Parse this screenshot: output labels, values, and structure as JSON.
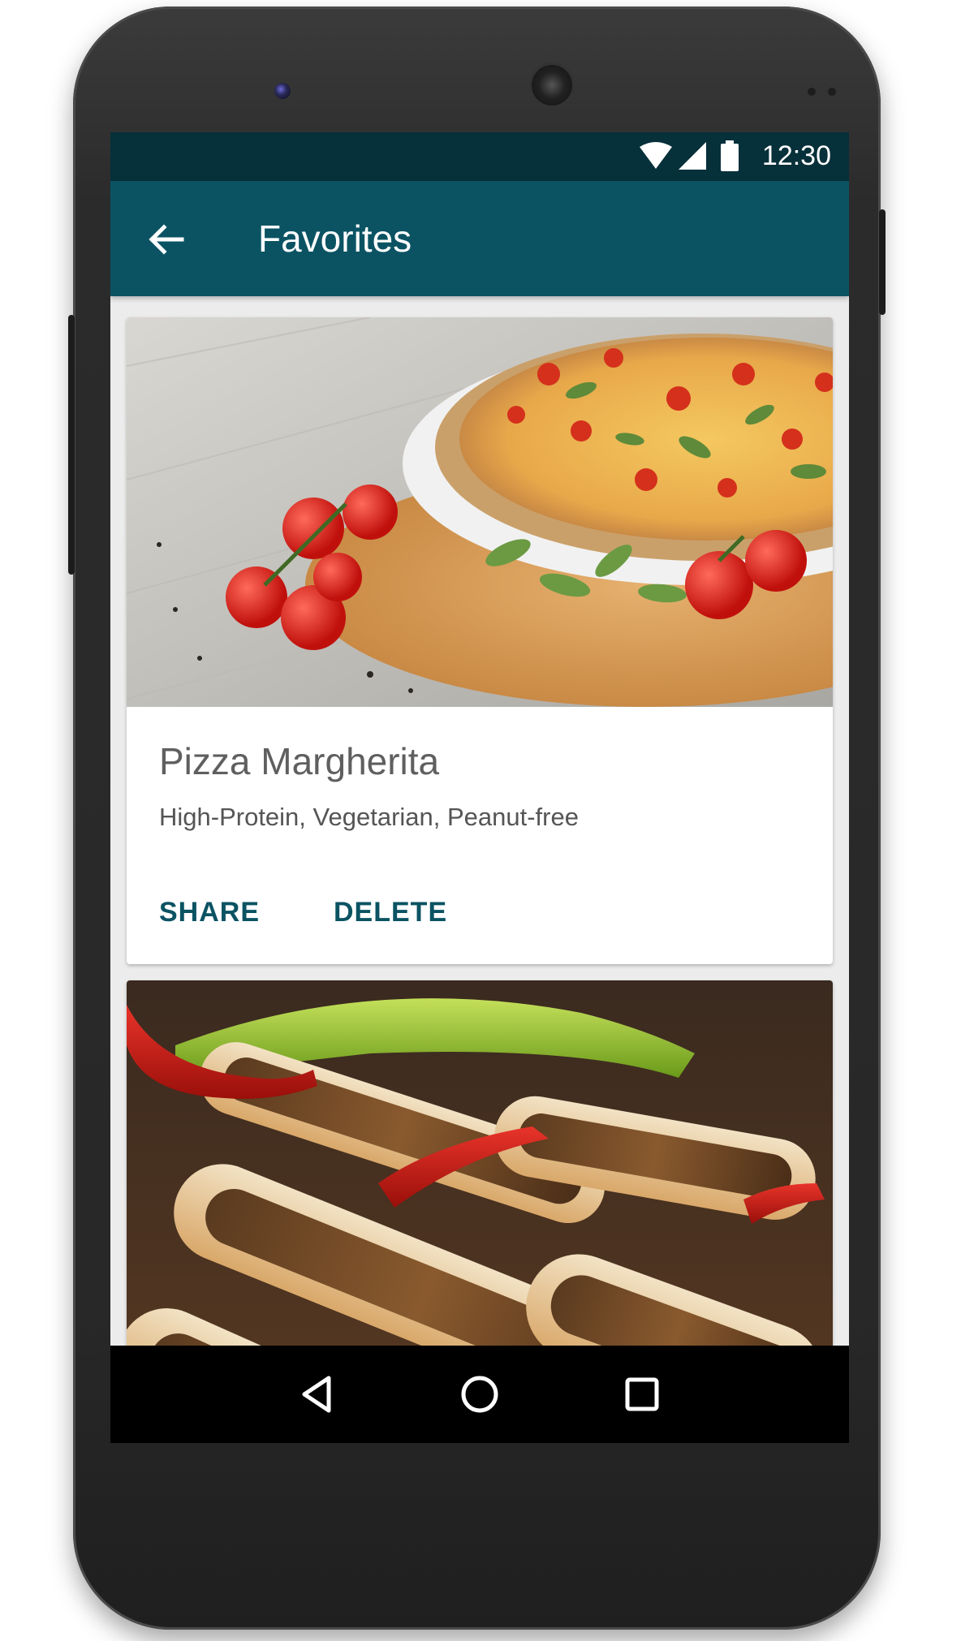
{
  "status_bar": {
    "time": "12:30",
    "icons": [
      "wifi-icon",
      "signal-icon",
      "battery-icon"
    ]
  },
  "app_bar": {
    "title": "Favorites",
    "nav_icon": "arrow-back-icon",
    "color": "#0b5363"
  },
  "cards": [
    {
      "title": "Pizza Margherita",
      "subtitle": "High-Protein, Vegetarian, Peanut-free",
      "image": "pizza-photo",
      "actions": [
        "SHARE",
        "DELETE"
      ]
    },
    {
      "image": "sandwich-photo"
    }
  ],
  "nav_bar": {
    "buttons": [
      "back-triangle-icon",
      "home-circle-icon",
      "recents-square-icon"
    ]
  },
  "colors": {
    "status_bar": "#06303a",
    "app_bar": "#0b5363",
    "accent": "#0b5363",
    "background": "#ececec"
  }
}
